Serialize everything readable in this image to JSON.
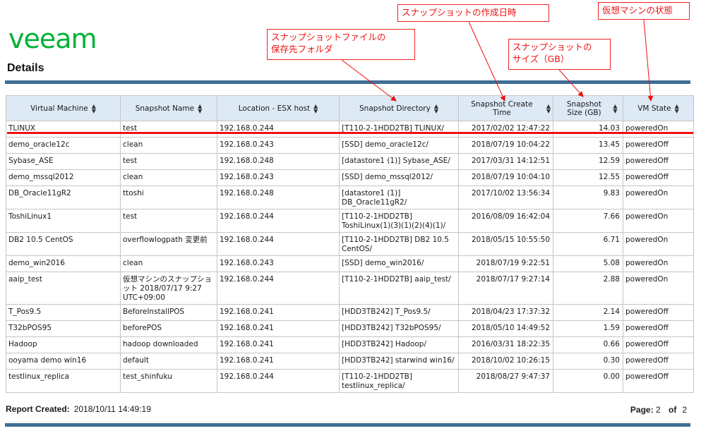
{
  "header": {
    "logo_text": "veeam",
    "brand_color": "#00b336",
    "title": "Details"
  },
  "annotations": {
    "directory": "スナップショットファイルの\n保存先フォルダ",
    "create_time": "スナップショットの作成日時",
    "size": "スナップショットの\nサイズ（GB）",
    "vm_state": "仮想マシンの状態",
    "color": "#ee1111"
  },
  "table": {
    "columns": [
      "Virtual Machine",
      "Snapshot Name",
      "Location - ESX host",
      "Snapshot Directory",
      "Snapshot Create Time",
      "Snapshot Size (GB)",
      "VM State"
    ],
    "rows": [
      [
        "TLINUX",
        "test",
        "192.168.0.244",
        "[T110-2-1HDD2TB] TLINUX/",
        "2017/02/02 12:47:22",
        "14.03",
        "poweredOn"
      ],
      [
        "demo_oracle12c",
        "clean",
        "192.168.0.243",
        "[SSD] demo_oracle12c/",
        "2018/07/19 10:04:22",
        "13.45",
        "poweredOff"
      ],
      [
        "Sybase_ASE",
        "test",
        "192.168.0.248",
        "[datastore1 (1)] Sybase_ASE/",
        "2017/03/31 14:12:51",
        "12.59",
        "poweredOff"
      ],
      [
        "demo_mssql2012",
        "clean",
        "192.168.0.243",
        "[SSD] demo_mssql2012/",
        "2018/07/19 10:04:10",
        "12.55",
        "poweredOff"
      ],
      [
        "DB_Oracle11gR2",
        "ttoshi",
        "192.168.0.248",
        "[datastore1 (1)] DB_Oracle11gR2/",
        "2017/10/02 13:56:34",
        "9.83",
        "poweredOn"
      ],
      [
        "ToshiLinux1",
        "test",
        "192.168.0.244",
        "[T110-2-1HDD2TB] ToshiLinux(1)(3)(1)(2)(4)(1)/",
        "2016/08/09 16:42:04",
        "7.66",
        "poweredOn"
      ],
      [
        "DB2 10.5 CentOS",
        "overflowlogpath 変更前",
        "192.168.0.244",
        "[T110-2-1HDD2TB] DB2 10.5 CentOS/",
        "2018/05/15 10:55:50",
        "6.71",
        "poweredOn"
      ],
      [
        "demo_win2016",
        "clean",
        "192.168.0.243",
        "[SSD] demo_win2016/",
        "2018/07/19 9:22:51",
        "5.08",
        "poweredOn"
      ],
      [
        "aaip_test",
        "仮想マシンのスナップショット 2018/07/17 9:27 UTC+09:00",
        "192.168.0.244",
        "[T110-2-1HDD2TB] aaip_test/",
        "2018/07/17 9:27:14",
        "2.88",
        "poweredOn"
      ],
      [
        "T_Pos9.5",
        "BeforeInstallPOS",
        "192.168.0.241",
        "[HDD3TB242] T_Pos9.5/",
        "2018/04/23 17:37:32",
        "2.14",
        "poweredOff"
      ],
      [
        "T32bPOS95",
        "beforePOS",
        "192.168.0.241",
        "[HDD3TB242] T32bPOS95/",
        "2018/05/10 14:49:52",
        "1.59",
        "poweredOff"
      ],
      [
        "Hadoop",
        "hadoop downloaded",
        "192.168.0.241",
        "[HDD3TB242] Hadoop/",
        "2016/03/31 18:22:35",
        "0.66",
        "poweredOff"
      ],
      [
        "ooyama demo win16",
        "default",
        "192.168.0.241",
        "[HDD3TB242] starwind win16/",
        "2018/10/02 10:26:15",
        "0.30",
        "poweredOff"
      ],
      [
        "testlinux_replica",
        "test_shinfuku",
        "192.168.0.244",
        "[T110-2-1HDD2TB] testlinux_replica/",
        "2018/08/27 9:47:37",
        "0.00",
        "poweredOff"
      ]
    ]
  },
  "footer": {
    "report_label": "Report Created:",
    "report_value": "2018/10/11 14:49:19",
    "page_label": "Page:",
    "page_current": "2",
    "of_label": "of",
    "page_total": "2"
  },
  "colors": {
    "accent_bar": "#3f6d94",
    "header_bg": "#dde9f5",
    "highlight": "#ee1111"
  }
}
